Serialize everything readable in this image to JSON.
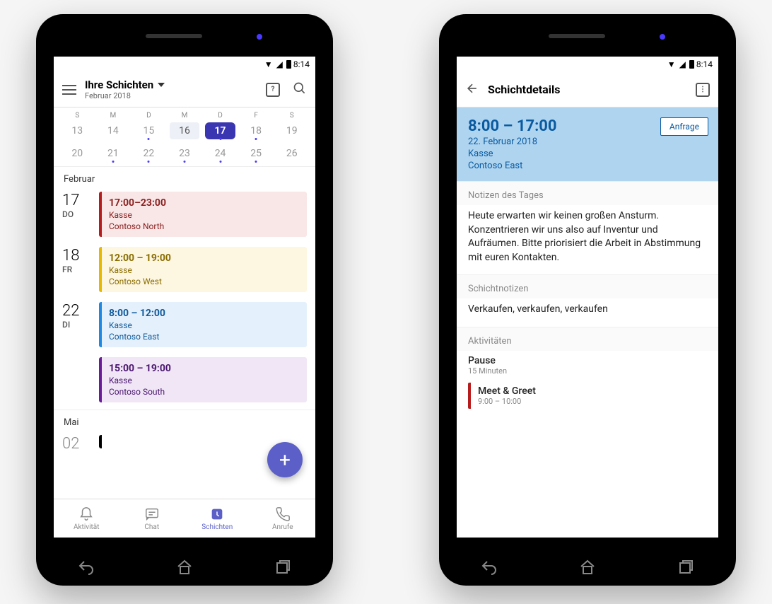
{
  "status": {
    "time": "8:14"
  },
  "left": {
    "title": "Ihre Schichten",
    "subtitle": "Februar 2018",
    "weekdays": [
      "S",
      "M",
      "D",
      "M",
      "D",
      "F",
      "S"
    ],
    "row1": [
      "13",
      "14",
      "15",
      "16",
      "17",
      "18",
      "19"
    ],
    "row2": [
      "20",
      "21",
      "22",
      "23",
      "24",
      "25",
      "26"
    ],
    "month1": "Februar",
    "shifts": [
      {
        "day": "17",
        "dow": "DO",
        "time": "17:00–23:00",
        "loc": "Kasse",
        "store": "Contoso North",
        "color": "red"
      },
      {
        "day": "18",
        "dow": "FR",
        "time": "12:00 – 19:00",
        "loc": "Kasse",
        "store": "Contoso West",
        "color": "yellow"
      },
      {
        "day": "22",
        "dow": "DI",
        "time": "8:00 – 12:00",
        "loc": "Kasse",
        "store": "Contoso East",
        "color": "blue"
      },
      {
        "day": "",
        "dow": "",
        "time": "15:00 – 19:00",
        "loc": "Kasse",
        "store": "Contoso South",
        "color": "purple"
      }
    ],
    "month2": "Mai",
    "partial_day": "02",
    "nav": {
      "activity": "Aktivität",
      "chat": "Chat",
      "shifts": "Schichten",
      "calls": "Anrufe"
    }
  },
  "right": {
    "title": "Schichtdetails",
    "time": "8:00 – 17:00",
    "date": "22. Februar 2018",
    "loc": "Kasse",
    "store": "Contoso East",
    "request": "Anfrage",
    "notes_day_label": "Notizen des Tages",
    "notes_day": "Heute erwarten wir keinen großen Ansturm. Konzentrieren wir uns also auf Inventur und Aufräumen. Bitte priorisiert die Arbeit in Abstimmung mit euren Kontakten.",
    "shift_notes_label": "Schichtnotizen",
    "shift_notes": "Verkaufen, verkaufen, verkaufen",
    "activities_label": "Aktivitäten",
    "pause_title": "Pause",
    "pause_sub": "15 Minuten",
    "meet_title": "Meet & Greet",
    "meet_sub": "9:00 – 10:00"
  }
}
